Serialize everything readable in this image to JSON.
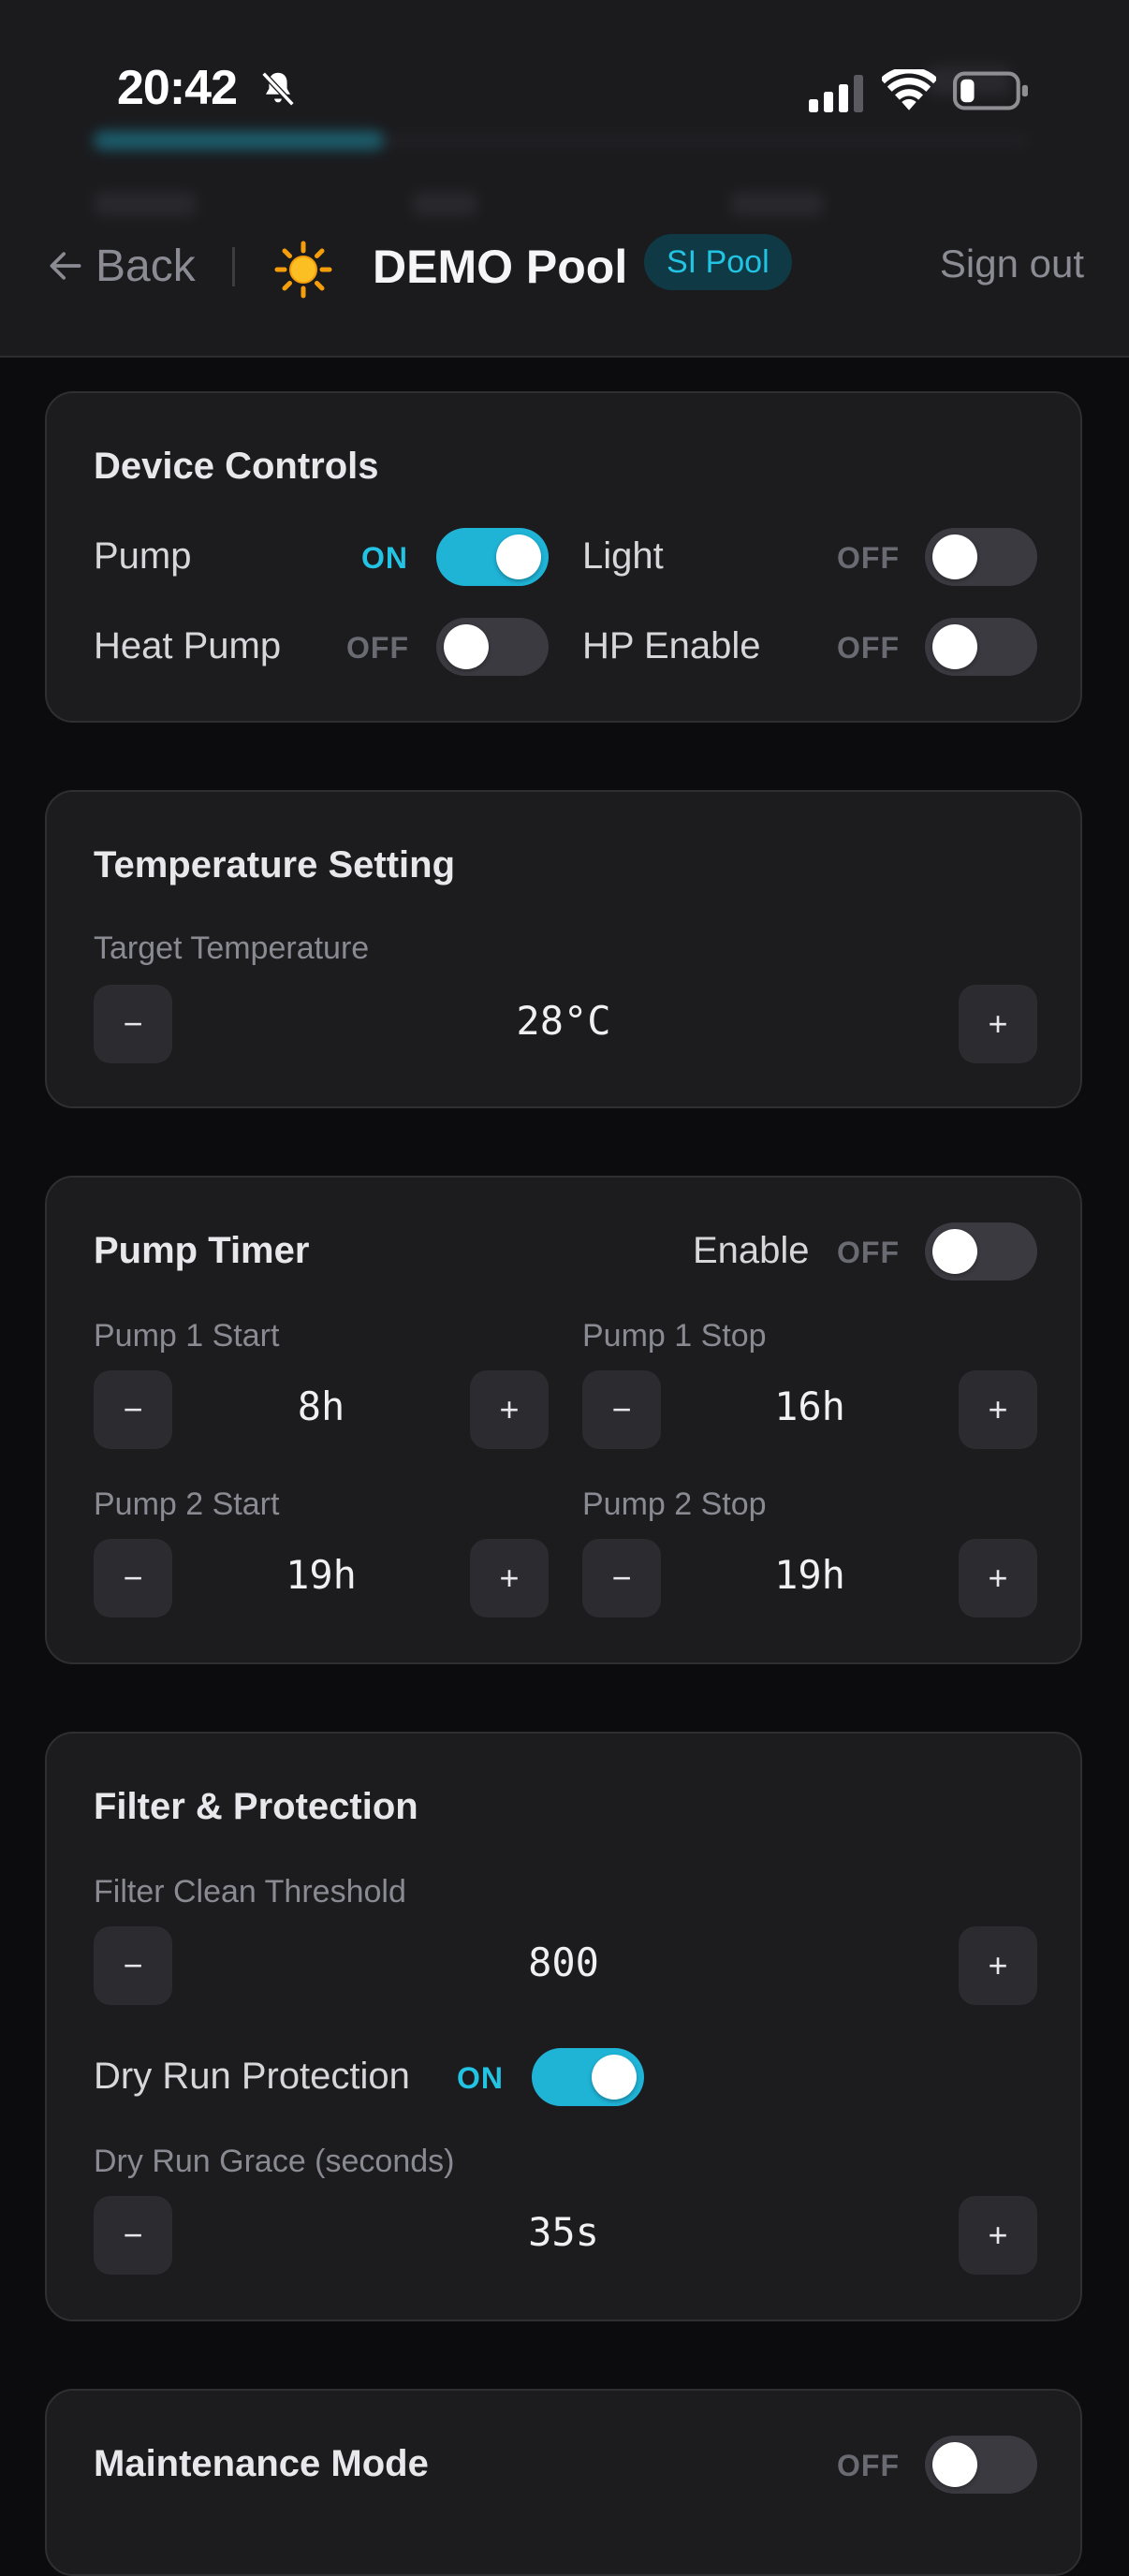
{
  "status_bar": {
    "time": "20:42"
  },
  "header": {
    "back_label": "Back",
    "title": "DEMO Pool",
    "badge": "SI Pool",
    "signout_label": "Sign out",
    "accent": "#22c3e3"
  },
  "device_controls": {
    "title": "Device Controls",
    "items": [
      {
        "label": "Pump",
        "state": "ON"
      },
      {
        "label": "Light",
        "state": "OFF"
      },
      {
        "label": "Heat Pump",
        "state": "OFF"
      },
      {
        "label": "HP Enable",
        "state": "OFF"
      }
    ]
  },
  "temperature": {
    "title": "Temperature Setting",
    "label": "Target Temperature",
    "value": "28°C",
    "minus": "−",
    "plus": "+"
  },
  "pump_timer": {
    "title": "Pump Timer",
    "enable_label": "Enable",
    "enable_state": "OFF",
    "p1_start": {
      "label": "Pump 1 Start",
      "value": "8h"
    },
    "p1_stop": {
      "label": "Pump 1 Stop",
      "value": "16h"
    },
    "p2_start": {
      "label": "Pump 2 Start",
      "value": "19h"
    },
    "p2_stop": {
      "label": "Pump 2 Stop",
      "value": "19h"
    },
    "minus": "−",
    "plus": "+"
  },
  "filter_protection": {
    "title": "Filter & Protection",
    "threshold_label": "Filter Clean Threshold",
    "threshold_value": "800",
    "dry_run_label": "Dry Run Protection",
    "dry_run_state": "ON",
    "grace_label": "Dry Run Grace (seconds)",
    "grace_value": "35s",
    "minus": "−",
    "plus": "+"
  },
  "next_card": {
    "title": "Maintenance Mode",
    "state": "OFF"
  }
}
